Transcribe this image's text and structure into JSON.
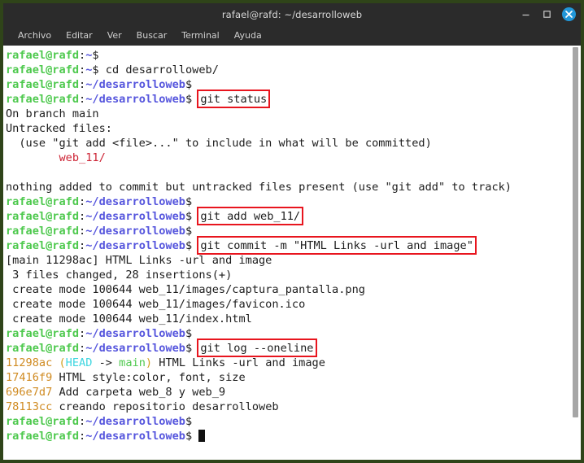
{
  "window": {
    "title": "rafael@rafd: ~/desarrolloweb",
    "controls": {
      "minimize": "minimize-button",
      "maximize": "maximize-button",
      "close": "close-button"
    },
    "accent_close": "#2196d8",
    "frame_color": "#2f4419",
    "titlebar_color": "#2b2b2b"
  },
  "menubar": {
    "items": [
      {
        "label": "Archivo"
      },
      {
        "label": "Editar"
      },
      {
        "label": "Ver"
      },
      {
        "label": "Buscar"
      },
      {
        "label": "Terminal"
      },
      {
        "label": "Ayuda"
      }
    ]
  },
  "prompt": {
    "user": "rafael@rafd",
    "colon": ":",
    "home_path": "~",
    "project_path": "~/desarrolloweb",
    "sigil": "$"
  },
  "terminal": {
    "background": "#ffffff",
    "foreground": "#1c1c1c",
    "colors": {
      "user_green": "#4ec94e",
      "path_blue": "#5555dd",
      "untracked_red": "#cc2233",
      "hash_orange": "#d08b22",
      "head_cyan": "#3fd6e0",
      "branch_green": "#4ec94e",
      "paren_yellow": "#d0a020",
      "annotation_box": "#e8151e"
    },
    "lines": [
      {
        "type": "prompt",
        "path": "~",
        "command": ""
      },
      {
        "type": "prompt",
        "path": "~",
        "command": "cd desarrolloweb/"
      },
      {
        "type": "prompt",
        "path": "~/desarrolloweb",
        "command": ""
      },
      {
        "type": "prompt",
        "path": "~/desarrolloweb",
        "command": "git status",
        "boxed": true
      },
      {
        "type": "output",
        "text": "On branch main"
      },
      {
        "type": "output",
        "text": "Untracked files:"
      },
      {
        "type": "output",
        "text": "  (use \"git add <file>...\" to include in what will be committed)"
      },
      {
        "type": "output_red",
        "indent": "        ",
        "text": "web_11/"
      },
      {
        "type": "output",
        "text": ""
      },
      {
        "type": "output",
        "text": "nothing added to commit but untracked files present (use \"git add\" to track)"
      },
      {
        "type": "prompt",
        "path": "~/desarrolloweb",
        "command": ""
      },
      {
        "type": "prompt",
        "path": "~/desarrolloweb",
        "command": "git add web_11/",
        "boxed": true
      },
      {
        "type": "prompt",
        "path": "~/desarrolloweb",
        "command": ""
      },
      {
        "type": "prompt",
        "path": "~/desarrolloweb",
        "command": "git commit -m \"HTML Links -url and image\"",
        "boxed": true
      },
      {
        "type": "output",
        "text": "[main 11298ac] HTML Links -url and image"
      },
      {
        "type": "output",
        "text": " 3 files changed, 28 insertions(+)"
      },
      {
        "type": "output",
        "text": " create mode 100644 web_11/images/captura_pantalla.png"
      },
      {
        "type": "output",
        "text": " create mode 100644 web_11/images/favicon.ico"
      },
      {
        "type": "output",
        "text": " create mode 100644 web_11/index.html"
      },
      {
        "type": "prompt",
        "path": "~/desarrolloweb",
        "command": ""
      },
      {
        "type": "prompt",
        "path": "~/desarrolloweb",
        "command": "git log --oneline",
        "boxed": true
      },
      {
        "type": "log_head",
        "hash": "11298ac",
        "open_paren": "(",
        "head": "HEAD",
        "arrow": " -> ",
        "branch": "main",
        "close_paren": ")",
        "message": " HTML Links -url and image"
      },
      {
        "type": "log",
        "hash": "17416f9",
        "message": " HTML style:color, font, size"
      },
      {
        "type": "log",
        "hash": "696e7d7",
        "message": " Add carpeta web_8 y web_9"
      },
      {
        "type": "log",
        "hash": "78113cc",
        "message": " creando repositorio desarrolloweb"
      },
      {
        "type": "prompt",
        "path": "~/desarrolloweb",
        "command": ""
      },
      {
        "type": "prompt_cursor",
        "path": "~/desarrolloweb",
        "command": ""
      }
    ]
  },
  "scrollbar": {
    "thumb_color": "#a6a6a6",
    "position_label": "scroll-thumb"
  }
}
